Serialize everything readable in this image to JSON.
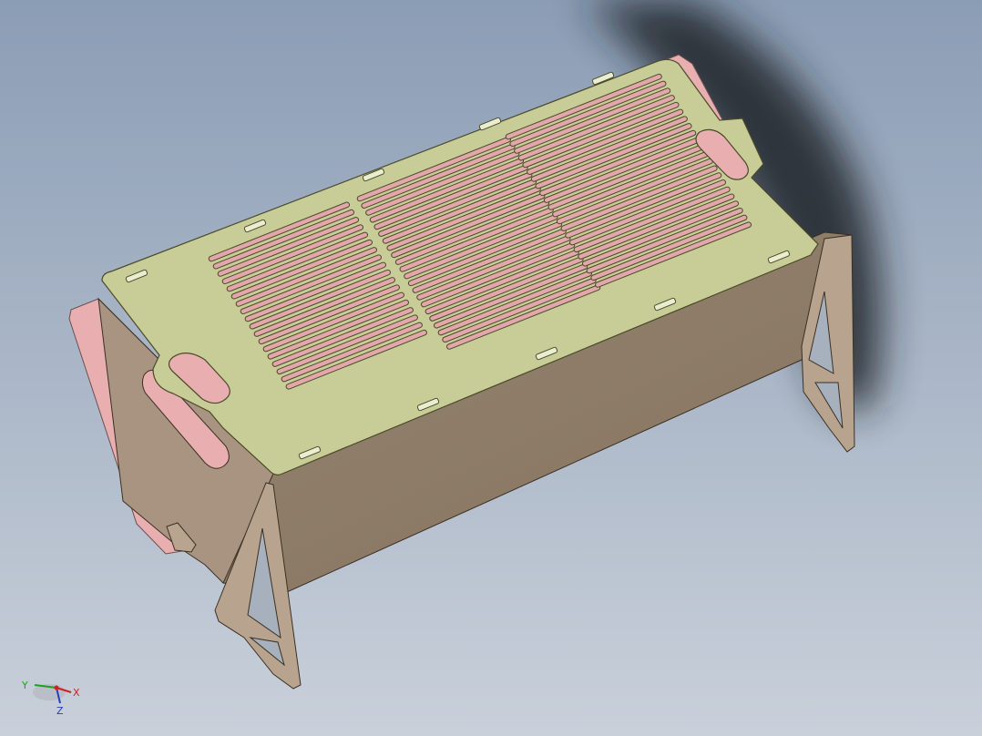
{
  "viewport": {
    "colors": {
      "background_top": "#8b9db5",
      "background_bottom": "#c9d0da",
      "grate": "#c8cc96",
      "grate_edge": "#5a5a3a",
      "body_side": "#8a7a68",
      "body_side_light": "#a89480",
      "end_panel": "#e9aeb0",
      "slot": "#e3a7ab",
      "shadow": "#1e2128"
    }
  },
  "triad": {
    "x_label": "X",
    "y_label": "Y",
    "z_label": "Z",
    "colors": {
      "x": "#d22020",
      "y": "#20a020",
      "z": "#2040c0"
    }
  }
}
